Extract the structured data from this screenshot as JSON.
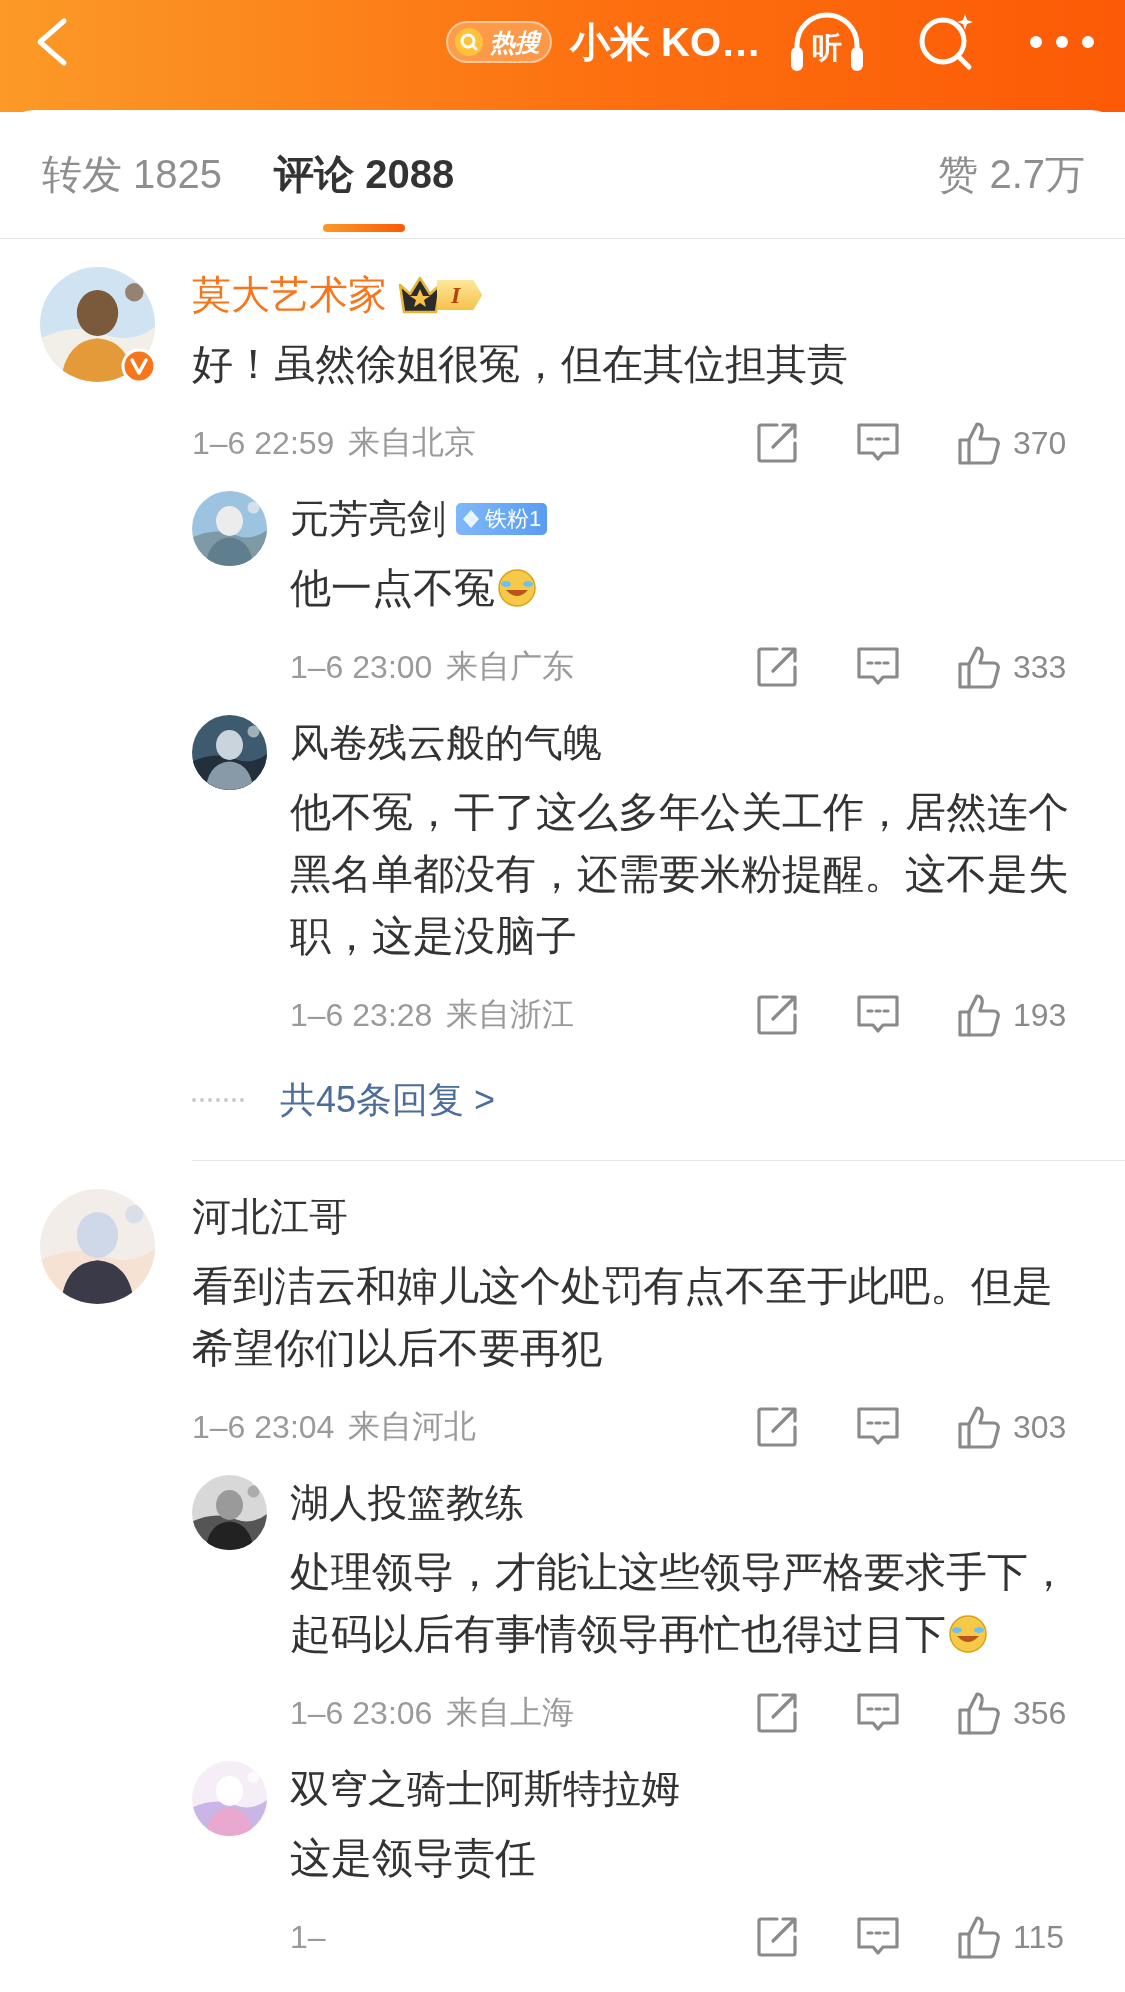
{
  "header": {
    "hot_label": "热搜",
    "title": "小米 KO…",
    "listen_label": "听"
  },
  "tabs": [
    {
      "label": "转发 1825",
      "selected": false
    },
    {
      "label": "评论 2088",
      "selected": true
    },
    {
      "label": "赞 2.7万",
      "selected": false
    }
  ],
  "comments": [
    {
      "name": "莫大艺术家",
      "vip": true,
      "verified": true,
      "badge": {
        "kind": "crown",
        "label": "I"
      },
      "text": "好！虽然徐姐很冤，但在其位担其责",
      "time": "1–6 22:59",
      "location": "来自北京",
      "likes": "370",
      "more_replies": "共45条回复 >",
      "replies": [
        {
          "name": "元芳亮剑",
          "vip": false,
          "badge": {
            "kind": "fan",
            "label": "铁粉1"
          },
          "text": "他一点不冤",
          "emoji": true,
          "time": "1–6 23:00",
          "location": "来自广东",
          "likes": "333"
        },
        {
          "name": "风卷残云般的气魄",
          "vip": false,
          "text": "他不冤，干了这么多年公关工作，居然连个黑名单都没有，还需要米粉提醒。这不是失职，这是没脑子",
          "time": "1–6 23:28",
          "location": "来自浙江",
          "likes": "193"
        }
      ]
    },
    {
      "name": "河北江哥",
      "vip": false,
      "verified": false,
      "text": "看到洁云和婶儿这个处罚有点不至于此吧。但是希望你们以后不要再犯",
      "time": "1–6 23:04",
      "location": "来自河北",
      "likes": "303",
      "replies": [
        {
          "name": "湖人投篮教练",
          "vip": false,
          "text": "处理领导，才能让这些领导严格要求手下，起码以后有事情领导再忙也得过目下",
          "emoji": true,
          "time": "1–6 23:06",
          "location": "来自上海",
          "likes": "356"
        },
        {
          "name": "双穹之骑士阿斯特拉姆",
          "vip": false,
          "text": "这是领导责任",
          "time": "1–",
          "likes": "115"
        }
      ]
    }
  ]
}
